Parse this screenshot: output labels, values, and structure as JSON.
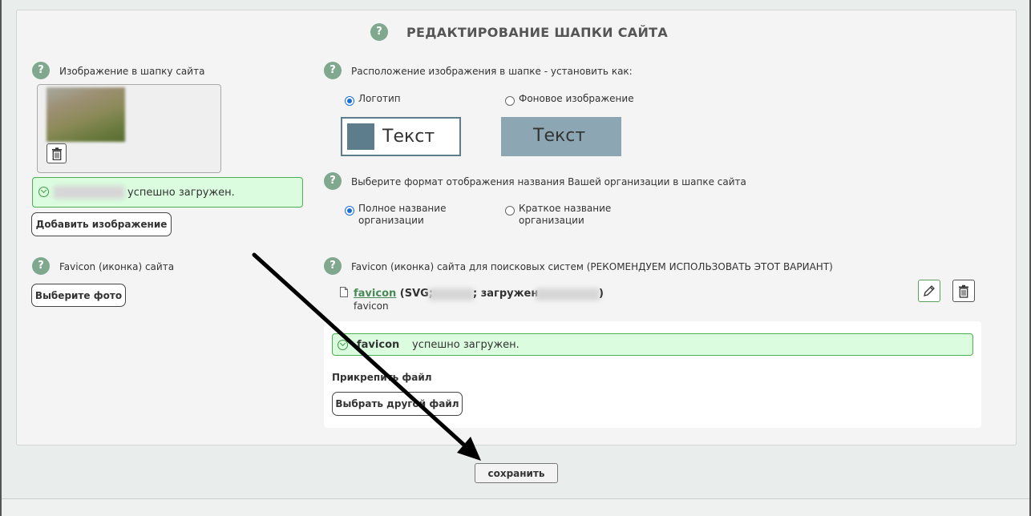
{
  "header": {
    "title": "РЕДАКТИРОВАНИЕ ШАПКИ САЙТА",
    "help_glyph": "?"
  },
  "image_section": {
    "label": "Изображение в шапку сайта",
    "success_text": "успешно загружен.",
    "add_button": "Добавить изображение"
  },
  "favicon_section": {
    "label": "Favicon (иконка) сайта",
    "choose_button": "Выберите фото"
  },
  "placement_section": {
    "label": "Расположение изображения в шапке - установить как:",
    "options": [
      {
        "label": "Логотип",
        "selected": true
      },
      {
        "label": "Фоновое изображение",
        "selected": false
      }
    ],
    "preview_text": "Текст"
  },
  "name_format_section": {
    "label": "Выберите формат отображения названия Вашей организации в шапке сайта",
    "options": [
      {
        "label_line1": "Полное название",
        "label_line2": "организации",
        "selected": true
      },
      {
        "label_line1": "Краткое название",
        "label_line2": "организации",
        "selected": false
      }
    ]
  },
  "search_favicon_section": {
    "label": "Favicon (иконка) сайта для поисковых систем (РЕКОМЕНДУЕМ ИСПОЛЬЗОВАТЬ ЭТОТ ВАРИАНТ)",
    "file_link": "favicon",
    "file_meta_prefix": "(SVG;",
    "file_meta_loaded": "; загружен",
    "file_meta_close": ")",
    "file_caption": "favicon",
    "success_name": "favicon",
    "success_text": "успешно загружен.",
    "attach_label": "Прикрепить файл",
    "choose_other_button": "Выбрать другой файл"
  },
  "footer": {
    "save_button": "сохранить"
  },
  "colors": {
    "help_badge": "#7fa88f",
    "success_bg": "#dbfcde",
    "success_border": "#4caf50",
    "radio_selected": "#1a6ed8",
    "logo_preview": "#5d7d8d",
    "bg_preview": "#8ca7b3",
    "annotation_arrow": "#000000"
  },
  "icons": [
    "help-icon",
    "trash-icon",
    "check-circle-icon",
    "file-icon",
    "pencil-icon",
    "arrow-annotation"
  ]
}
